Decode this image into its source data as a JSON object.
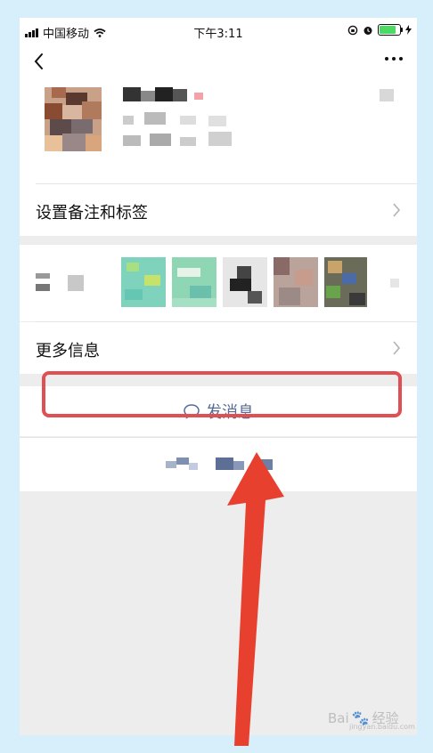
{
  "status_bar": {
    "carrier": "中国移动",
    "time": "下午3:11",
    "battery_level": 0.75
  },
  "rows": {
    "remark_label": "设置备注和标签",
    "more_info_label": "更多信息"
  },
  "actions": {
    "send_message_label": "发消息"
  },
  "watermark": {
    "brand": "Bai",
    "brand_suffix": "经验",
    "sub": "jingyan.baidu.com"
  },
  "colors": {
    "link_blue": "#576b95",
    "annotation_red": "#e04f52",
    "arrow_red": "#e8402e",
    "frame_bg": "#d7eefb"
  }
}
